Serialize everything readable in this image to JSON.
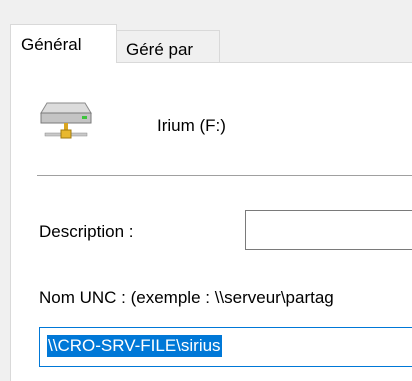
{
  "tabs": [
    {
      "label": "Général",
      "selected": true
    },
    {
      "label": "Géré par",
      "selected": false
    }
  ],
  "drive": {
    "label": "Irium (F:)",
    "icon": "network-drive-icon"
  },
  "description": {
    "label": "Description :",
    "value": ""
  },
  "unc": {
    "label": "Nom UNC : (exemple : \\\\serveur\\partag",
    "value": "\\\\CRO-SRV-FILE\\sirius"
  },
  "colors": {
    "selection": "#0078d7",
    "panel": "#ffffff",
    "background": "#f0f0f0"
  }
}
